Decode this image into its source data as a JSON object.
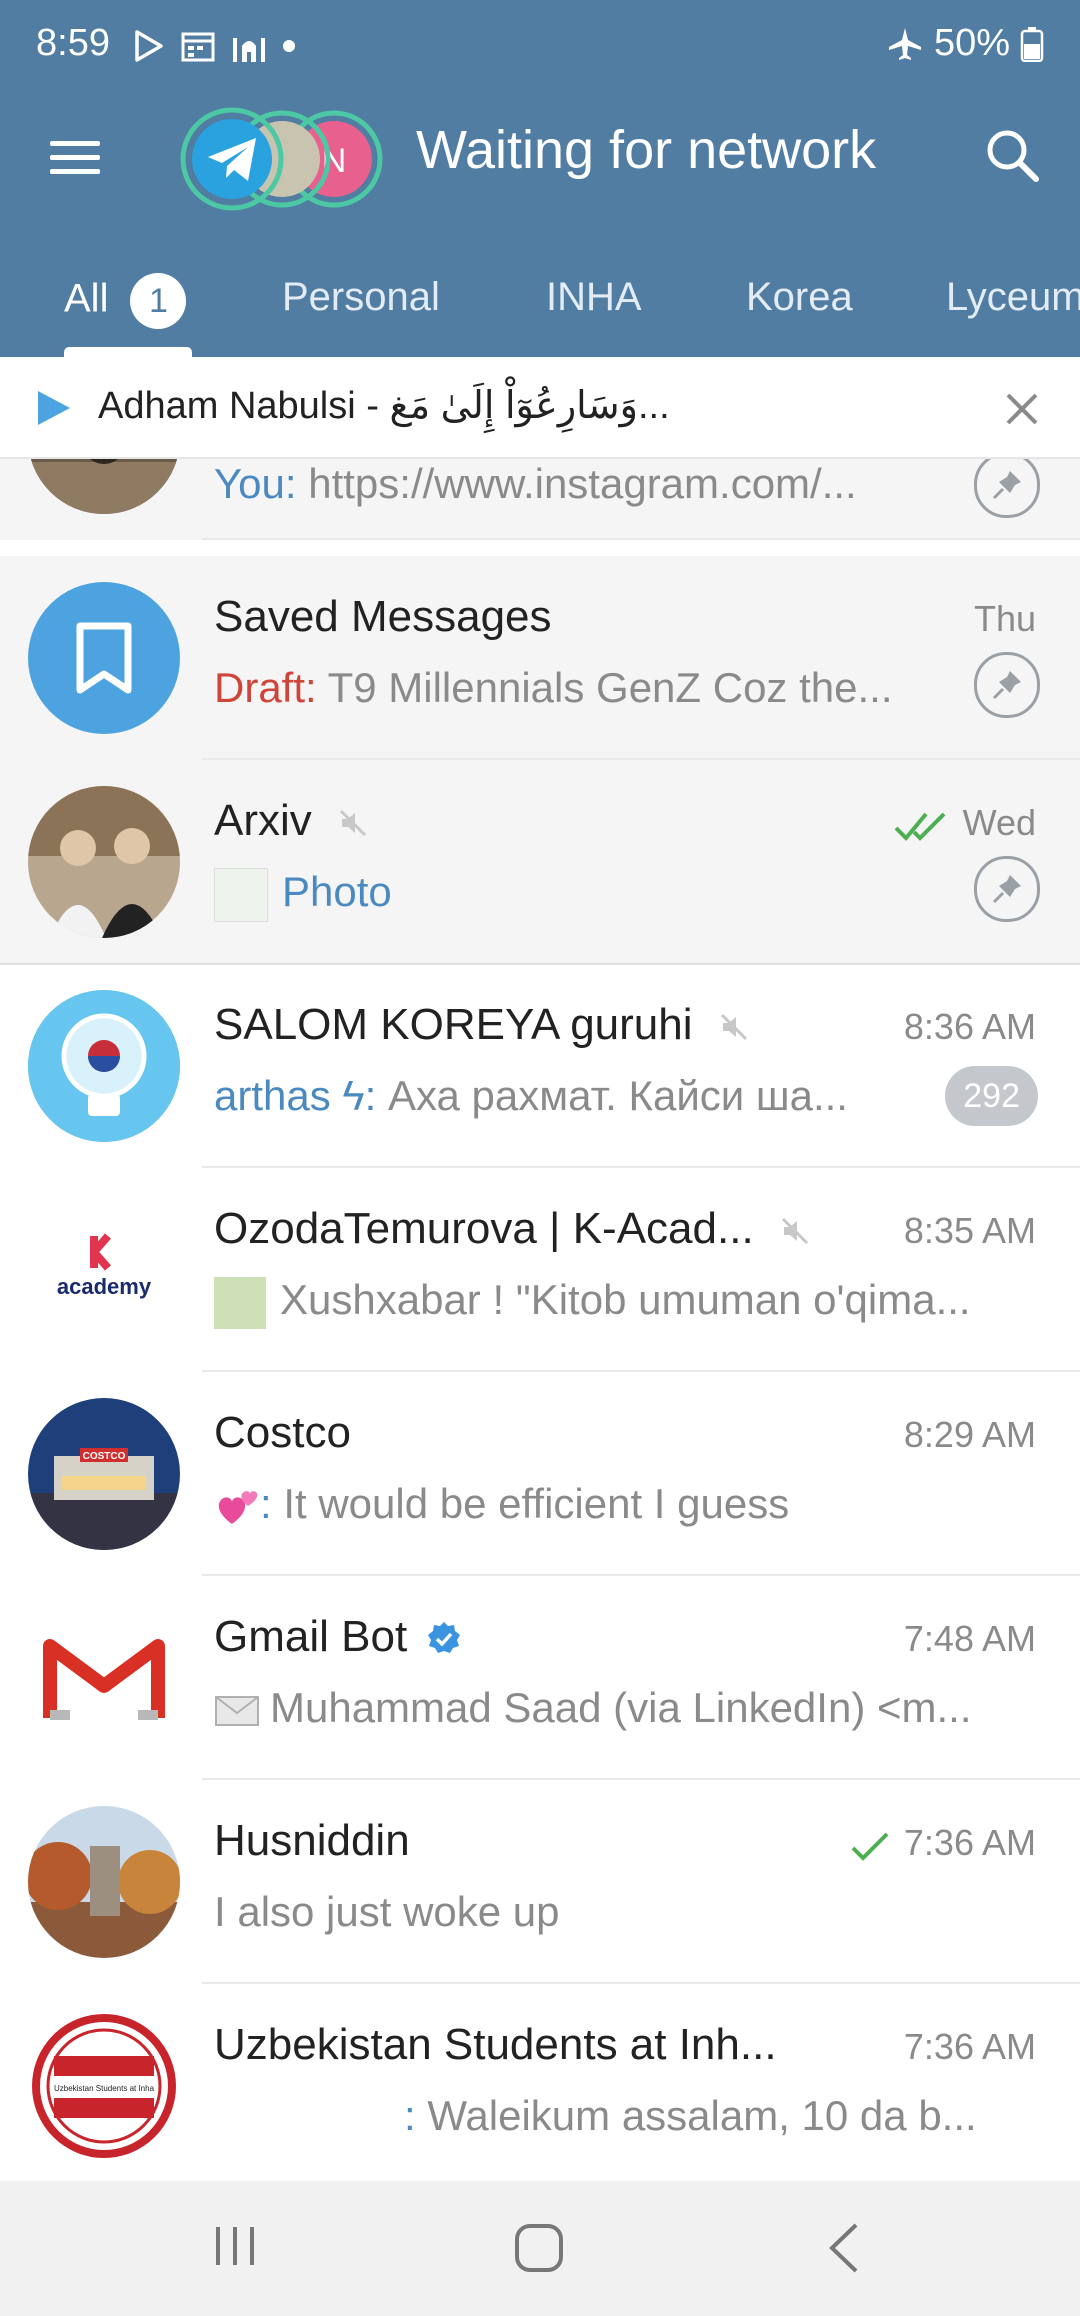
{
  "status_bar": {
    "time": "8:59",
    "battery": "50%"
  },
  "toolbar": {
    "title": "Waiting for network",
    "story_initial": "N"
  },
  "tabs": [
    {
      "label": "All",
      "badge": "1"
    },
    {
      "label": "Personal"
    },
    {
      "label": "INHA"
    },
    {
      "label": "Korea"
    },
    {
      "label": "Lyceum"
    }
  ],
  "player": {
    "text": "Adham Nabulsi - وَسَارِعُوٓاْ إِلَىٰ مَغ..."
  },
  "chats": [
    {
      "name": "",
      "sender": "You:",
      "preview": " https://www.instagram.com/...",
      "time": ""
    },
    {
      "name": "Saved Messages",
      "sender": "Draft:",
      "preview": " T9 Millennials GenZ Coz the...",
      "time": "Thu"
    },
    {
      "name": "Arxiv",
      "preview": "Photo",
      "time": "Wed"
    },
    {
      "name": "SALOM KOREYA guruhi",
      "sender": "arthas ϟ:",
      "preview": " Аха рахмат. Кайси ша...",
      "time": "8:36 AM",
      "unread": "292"
    },
    {
      "name": "OzodaTemurova | K-Acad...",
      "preview": "Xushxabar !  \"Kitob umuman o'qima...",
      "time": "8:35 AM",
      "avatar_text": "academy"
    },
    {
      "name": "Costco",
      "sender": ":",
      "preview": " It would be efficient I guess",
      "time": "8:29 AM",
      "avatar_text": "COSTCO"
    },
    {
      "name": "Gmail Bot",
      "preview": "Muhammad Saad (via LinkedIn) <m...",
      "time": "7:48 AM"
    },
    {
      "name": "Husniddin",
      "preview": "I also just woke up",
      "time": "7:36 AM"
    },
    {
      "name": "Uzbekistan Students at Inh...",
      "sender": ":",
      "preview": " Waleikum assalam, 10 da b...",
      "time": "7:36 AM",
      "avatar_text": "Uzbekistan Students at Inha"
    }
  ],
  "colors": {
    "header": "#517da2",
    "accent": "#4b8ac0",
    "draft": "#d0453a",
    "check": "#4caf50",
    "badge_muted": "#c4c8cc"
  }
}
